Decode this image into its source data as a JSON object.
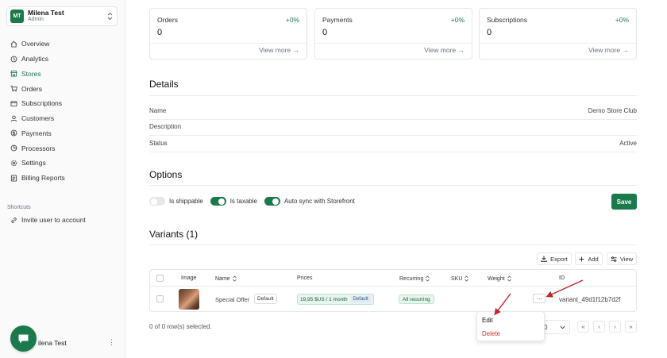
{
  "org": {
    "initials": "MT",
    "name": "Milena Test",
    "role": "Admin"
  },
  "nav": {
    "items": [
      {
        "label": "Overview",
        "icon": "home-icon"
      },
      {
        "label": "Analytics",
        "icon": "analytics-icon"
      },
      {
        "label": "Stores",
        "icon": "store-icon",
        "active": true
      },
      {
        "label": "Orders",
        "icon": "cart-icon"
      },
      {
        "label": "Subscriptions",
        "icon": "subscriptions-icon"
      },
      {
        "label": "Customers",
        "icon": "customers-icon"
      },
      {
        "label": "Payments",
        "icon": "payments-icon"
      },
      {
        "label": "Processors",
        "icon": "processors-icon"
      },
      {
        "label": "Settings",
        "icon": "settings-icon"
      },
      {
        "label": "Billing Reports",
        "icon": "billing-icon"
      }
    ]
  },
  "shortcuts": {
    "label": "Shortcuts",
    "items": [
      {
        "label": "Invite user to account",
        "icon": "link-icon"
      }
    ]
  },
  "user": {
    "name": "ilena Test",
    "menu": "⋮"
  },
  "stats": [
    {
      "title": "Orders",
      "change": "+0%",
      "value": "0",
      "link": "View more →"
    },
    {
      "title": "Payments",
      "change": "+0%",
      "value": "0",
      "link": "View more →"
    },
    {
      "title": "Subscriptions",
      "change": "+0%",
      "value": "0",
      "link": "View more →"
    }
  ],
  "details": {
    "title": "Details",
    "rows": [
      {
        "label": "Name",
        "value": "Demo Store Club"
      },
      {
        "label": "Description",
        "value": ""
      },
      {
        "label": "Status",
        "value": "Active"
      }
    ]
  },
  "options": {
    "title": "Options",
    "toggles": [
      {
        "label": "Is shippable",
        "on": false
      },
      {
        "label": "Is taxable",
        "on": true
      },
      {
        "label": "Auto sync with Storefront",
        "on": true
      }
    ],
    "save_label": "Save"
  },
  "variants": {
    "title": "Variants (1)",
    "toolbar": {
      "export": "Export",
      "add": "Add",
      "view": "View"
    },
    "columns": {
      "image": "Image",
      "name": "Name",
      "prices": "Prices",
      "recurring": "Recurring",
      "sku": "SKU",
      "weight": "Weight",
      "id": "ID"
    },
    "row": {
      "name": "Special Offer",
      "name_badge": "Default",
      "price": "19,95 $US / 1 month",
      "price_badge": "Default",
      "recurring": "All recurring",
      "sku": "",
      "weight": "",
      "id": "variant_49d1f12b7d2f",
      "more": "···"
    },
    "selected": "0 of 0 row(s) selected.",
    "page_size": "0",
    "pager": {
      "first": "«",
      "prev": "‹",
      "next": "›",
      "last": "»"
    }
  },
  "row_menu": {
    "edit": "Edit",
    "delete": "Delete"
  },
  "colors": {
    "accent": "#1a7a4c",
    "danger": "#d12f2f",
    "annotation": "#c0262a"
  }
}
